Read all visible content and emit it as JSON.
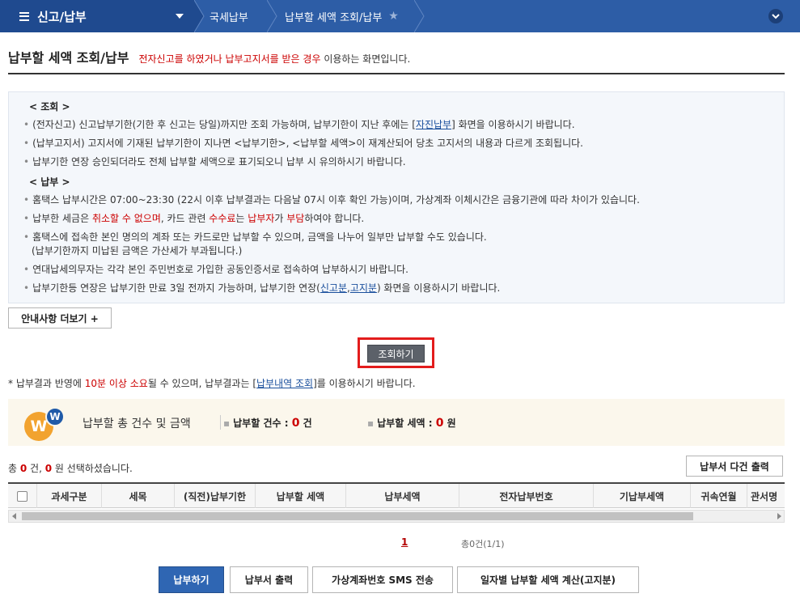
{
  "nav": {
    "menu_title": "신고/납부",
    "breadcrumbs": [
      "국세납부",
      "납부할 세액 조회/납부"
    ]
  },
  "page": {
    "title": "납부할 세액 조회/납부",
    "desc_red": "전자신고를 하였거나 납부고지서를 받은 경우",
    "desc_rest": " 이용하는 화면입니다."
  },
  "info": {
    "section1": "< 조회 >",
    "s1_line1_a": "(전자신고) 신고납부기한(기한 후 신고는 당일)까지만 조회 가능하며, 납부기한이 지난 후에는 [",
    "s1_line1_link": "자진납부",
    "s1_line1_b": "] 화면을 이용하시기 바랍니다.",
    "s1_line2": "(납부고지서) 고지서에 기재된 납부기한이 지나면 <납부기한>, <납부할 세액>이 재계산되어 당초 고지서의 내용과 다르게 조회됩니다.",
    "s1_line3": "납부기한 연장 승인되더라도 전체 납부할 세액으로 표기되오니 납부 시 유의하시기 바랍니다.",
    "section2": "< 납부 >",
    "s2_line1": "홈택스 납부시간은 07:00~23:30 (22시 이후 납부결과는 다음날 07시 이후 확인 가능)이며, 가상계좌 이체시간은 금융기관에 따라 차이가 있습니다.",
    "s2_line2_a": "납부한 세금은 ",
    "s2_line2_red1": "취소할 수 없으며",
    "s2_line2_b": ", 카드 관련 ",
    "s2_line2_red2": "수수료",
    "s2_line2_c": "는 ",
    "s2_line2_red3": "납부자",
    "s2_line2_d": "가 ",
    "s2_line2_red4": "부담",
    "s2_line2_e": "하여야 합니다.",
    "s2_line3": "홈택스에 접속한 본인 명의의 계좌 또는 카드로만 납부할 수 있으며, 금액을 나누어 일부만 납부할 수도 있습니다.",
    "s2_line3_sub": "(납부기한까지 미납된 금액은 가산세가 부과됩니다.)",
    "s2_line4": "연대납세의무자는 각각 본인 주민번호로 가입한 공동인증서로 접속하여 납부하시기 바랍니다.",
    "s2_line5_a": "납부기한등 연장은 납부기한 만료 3일 전까지 가능하며, 납부기한 연장(",
    "s2_line5_link1": "신고분",
    "s2_line5_comma": ",",
    "s2_line5_link2": "고지분",
    "s2_line5_b": ") 화면을 이용하시기 바랍니다."
  },
  "buttons": {
    "more": "안내사항 더보기 +",
    "search": "조회하기",
    "multi_print": "납부서 다건 출력",
    "pay": "납부하기",
    "print": "납부서 출력",
    "sms": "가상계좌번호 SMS 전송",
    "calc": "일자별 납부할 세액 계산(고지분)"
  },
  "note": {
    "a": "* 납부결과 반영에 ",
    "red": "10분 이상 소요",
    "b": "될 수 있으며, 납부결과는 [",
    "link": "납부내역 조회",
    "c": "]를 이용하시기 바랍니다."
  },
  "summary": {
    "label": "납부할 총 건수 및 금액",
    "count_label": "납부할 건수 : ",
    "count_value": "0",
    "count_unit": " 건",
    "amount_label": "납부할 세액 : ",
    "amount_value": "0",
    "amount_unit": " 원"
  },
  "selection": {
    "a": "총 ",
    "count": "0",
    "b": " 건, ",
    "amount": "0",
    "c": " 원 선택하셨습니다."
  },
  "table": {
    "headers": [
      "과세구분",
      "세목",
      "(직전)납부기한",
      "납부할 세액",
      "납부세액",
      "전자납부번호",
      "기납부세액",
      "귀속연월",
      "관서명"
    ]
  },
  "pager": {
    "page": "1",
    "total": "총0건(1/1)"
  },
  "colors": {
    "nav_bg": "#2d5da6",
    "accent_red": "#cc0000",
    "highlight_outline": "#e31c1c",
    "pay_button": "#2f66b3"
  }
}
